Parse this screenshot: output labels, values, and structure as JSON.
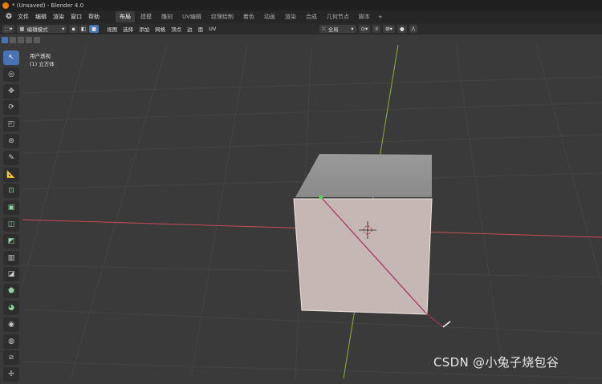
{
  "window": {
    "title": "* (Unsaved) - Blender 4.0"
  },
  "menu": {
    "items": [
      "文件",
      "编辑",
      "渲染",
      "窗口",
      "帮助"
    ]
  },
  "workspaces": {
    "tabs": [
      "布局",
      "建模",
      "雕刻",
      "UV编辑",
      "纹理绘制",
      "着色",
      "动画",
      "渲染",
      "合成",
      "几何节点",
      "脚本"
    ],
    "active": "布局",
    "add_label": "+"
  },
  "header": {
    "mode": "编辑模式",
    "menus": [
      "视图",
      "选择",
      "添加",
      "网格",
      "顶点",
      "边",
      "面",
      "UV"
    ],
    "transform_orientation": "全局",
    "falloff_label": "/\\"
  },
  "viewport": {
    "view_name": "用户透视",
    "object_name": "(1) 立方体"
  },
  "tools": [
    "select-box",
    "cursor",
    "move",
    "rotate",
    "scale",
    "transform",
    "annotate",
    "measure",
    "add-cube",
    "extrude",
    "inset",
    "bevel",
    "loop-cut",
    "knife",
    "poly-build",
    "spin",
    "smooth",
    "shrink-fatten",
    "shear",
    "rip"
  ],
  "watermark": "CSDN @小兔子烧包谷",
  "colors": {
    "accent": "#4772b3",
    "x_axis": "#c74c5a",
    "y_axis": "#8bb13a",
    "vertex": "#4ce04c",
    "edge": "#a8386a"
  }
}
